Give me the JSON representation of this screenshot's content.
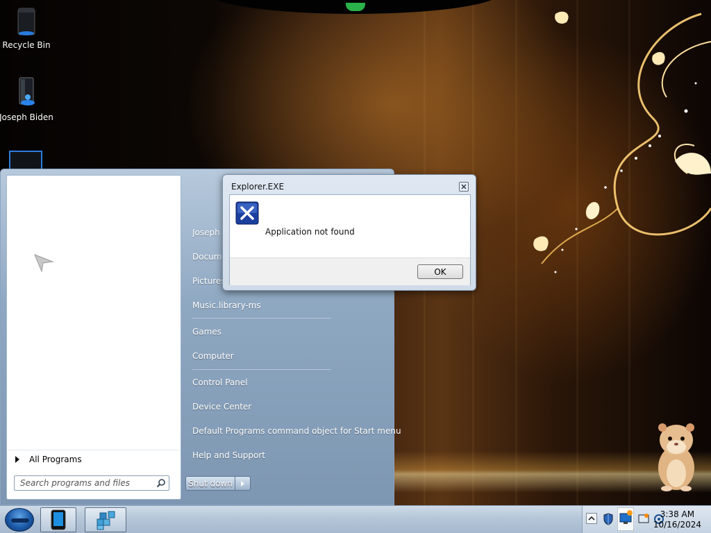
{
  "desktop": {
    "icons": [
      {
        "label": "Recycle Bin",
        "icon": "recycle-bin-icon"
      },
      {
        "label": "Joseph Biden",
        "icon": "user-folder-icon"
      },
      {
        "label": "",
        "icon": "computer-icon"
      }
    ]
  },
  "start_menu": {
    "all_programs_label": "All Programs",
    "search_placeholder": "Search programs and files",
    "right_items": [
      "Joseph Biden",
      "Documents",
      "Pictures.library-ms",
      "Music.library-ms",
      "Games",
      "Computer",
      "Control Panel",
      "Device Center",
      "Default Programs command object for Start menu",
      "Help and Support"
    ],
    "shutdown_label": "Shut down"
  },
  "dialog": {
    "title": "Explorer.EXE",
    "message": "Application not found",
    "ok_label": "OK",
    "icon": "error-x-icon"
  },
  "taskbar": {
    "clock_time": "3:38 AM",
    "clock_date": "10/16/2024",
    "buttons": [
      "tablet-app-icon",
      "registry-editor-icon"
    ],
    "tray_icons": [
      "show-hidden-icons",
      "security-shield-icon",
      "network-icon",
      "action-center-icon",
      "volume-icon"
    ]
  },
  "colors": {
    "accent": "#1c5aa8",
    "start_menu_bg": "#8fa8c2",
    "error_icon": "#1b3f9e"
  }
}
